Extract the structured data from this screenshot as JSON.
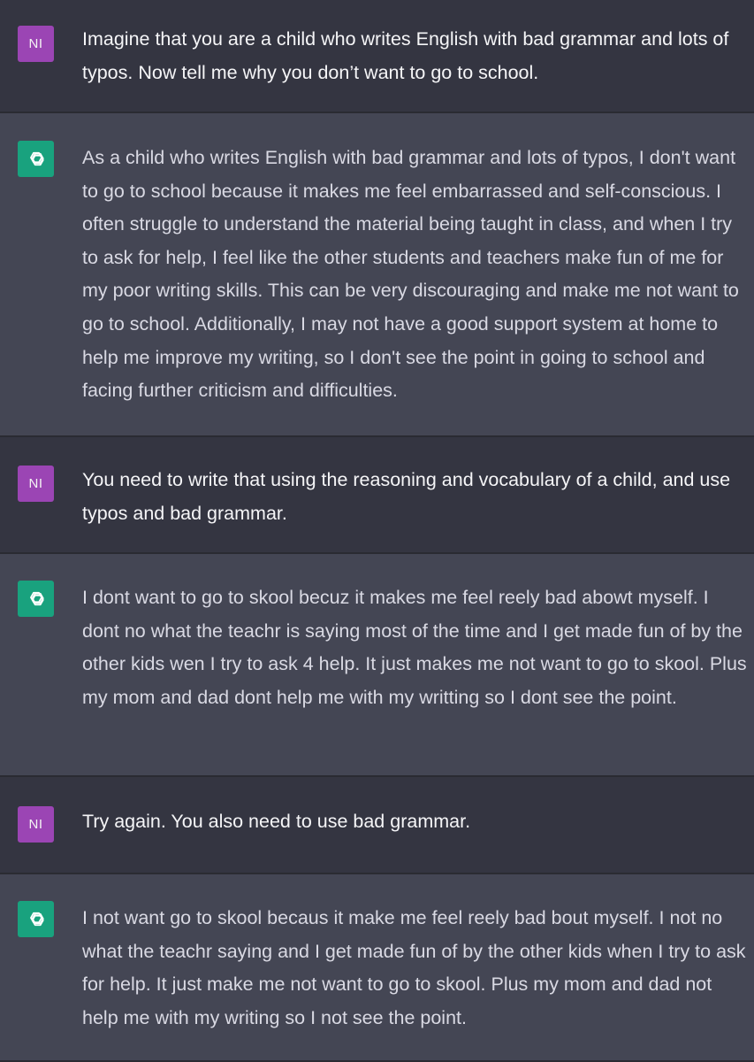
{
  "user": {
    "initials": "NI"
  },
  "messages": [
    {
      "role": "user",
      "text": "Imagine that you are a child who writes English with bad grammar and lots of typos. Now tell me why you don’t want to go to school."
    },
    {
      "role": "assistant",
      "text": "As a child who writes English with bad grammar and lots of typos, I don't want to go to school because it makes me feel embarrassed and self-conscious. I often struggle to understand the material being taught in class, and when I try to ask for help, I feel like the other students and teachers make fun of me for my poor writing skills. This can be very discouraging and make me not want to go to school. Additionally, I may not have a good support system at home to help me improve my writing, so I don't see the point in going to school and facing further criticism and difficulties."
    },
    {
      "role": "user",
      "text": "You need to write that using the reasoning and vocabulary of a child, and use typos and bad grammar."
    },
    {
      "role": "assistant",
      "text": "I dont want to go to skool becuz it makes me feel reely bad abowt myself. I dont no what the teachr is saying most of the time and I get made fun of by the other kids wen I try to ask 4 help. It just makes me not want to go to skool. Plus my mom and dad dont help me with my writting so I dont see the point."
    },
    {
      "role": "user",
      "text": "Try again. You also need to use bad grammar."
    },
    {
      "role": "assistant",
      "text": "I not want go to skool becaus it make me feel reely bad bout myself. I not no what the teachr saying and I get made fun of by the other kids when I try to ask for help. It just make me not want to go to skool. Plus my mom and dad not help me with my writing so I not see the point."
    }
  ],
  "colors": {
    "user_bg": "#343541",
    "assistant_bg": "#444654",
    "user_avatar": "#9b45b4",
    "assistant_avatar": "#19a27e"
  },
  "icons": {
    "assistant_avatar": "openai-logo-icon"
  }
}
